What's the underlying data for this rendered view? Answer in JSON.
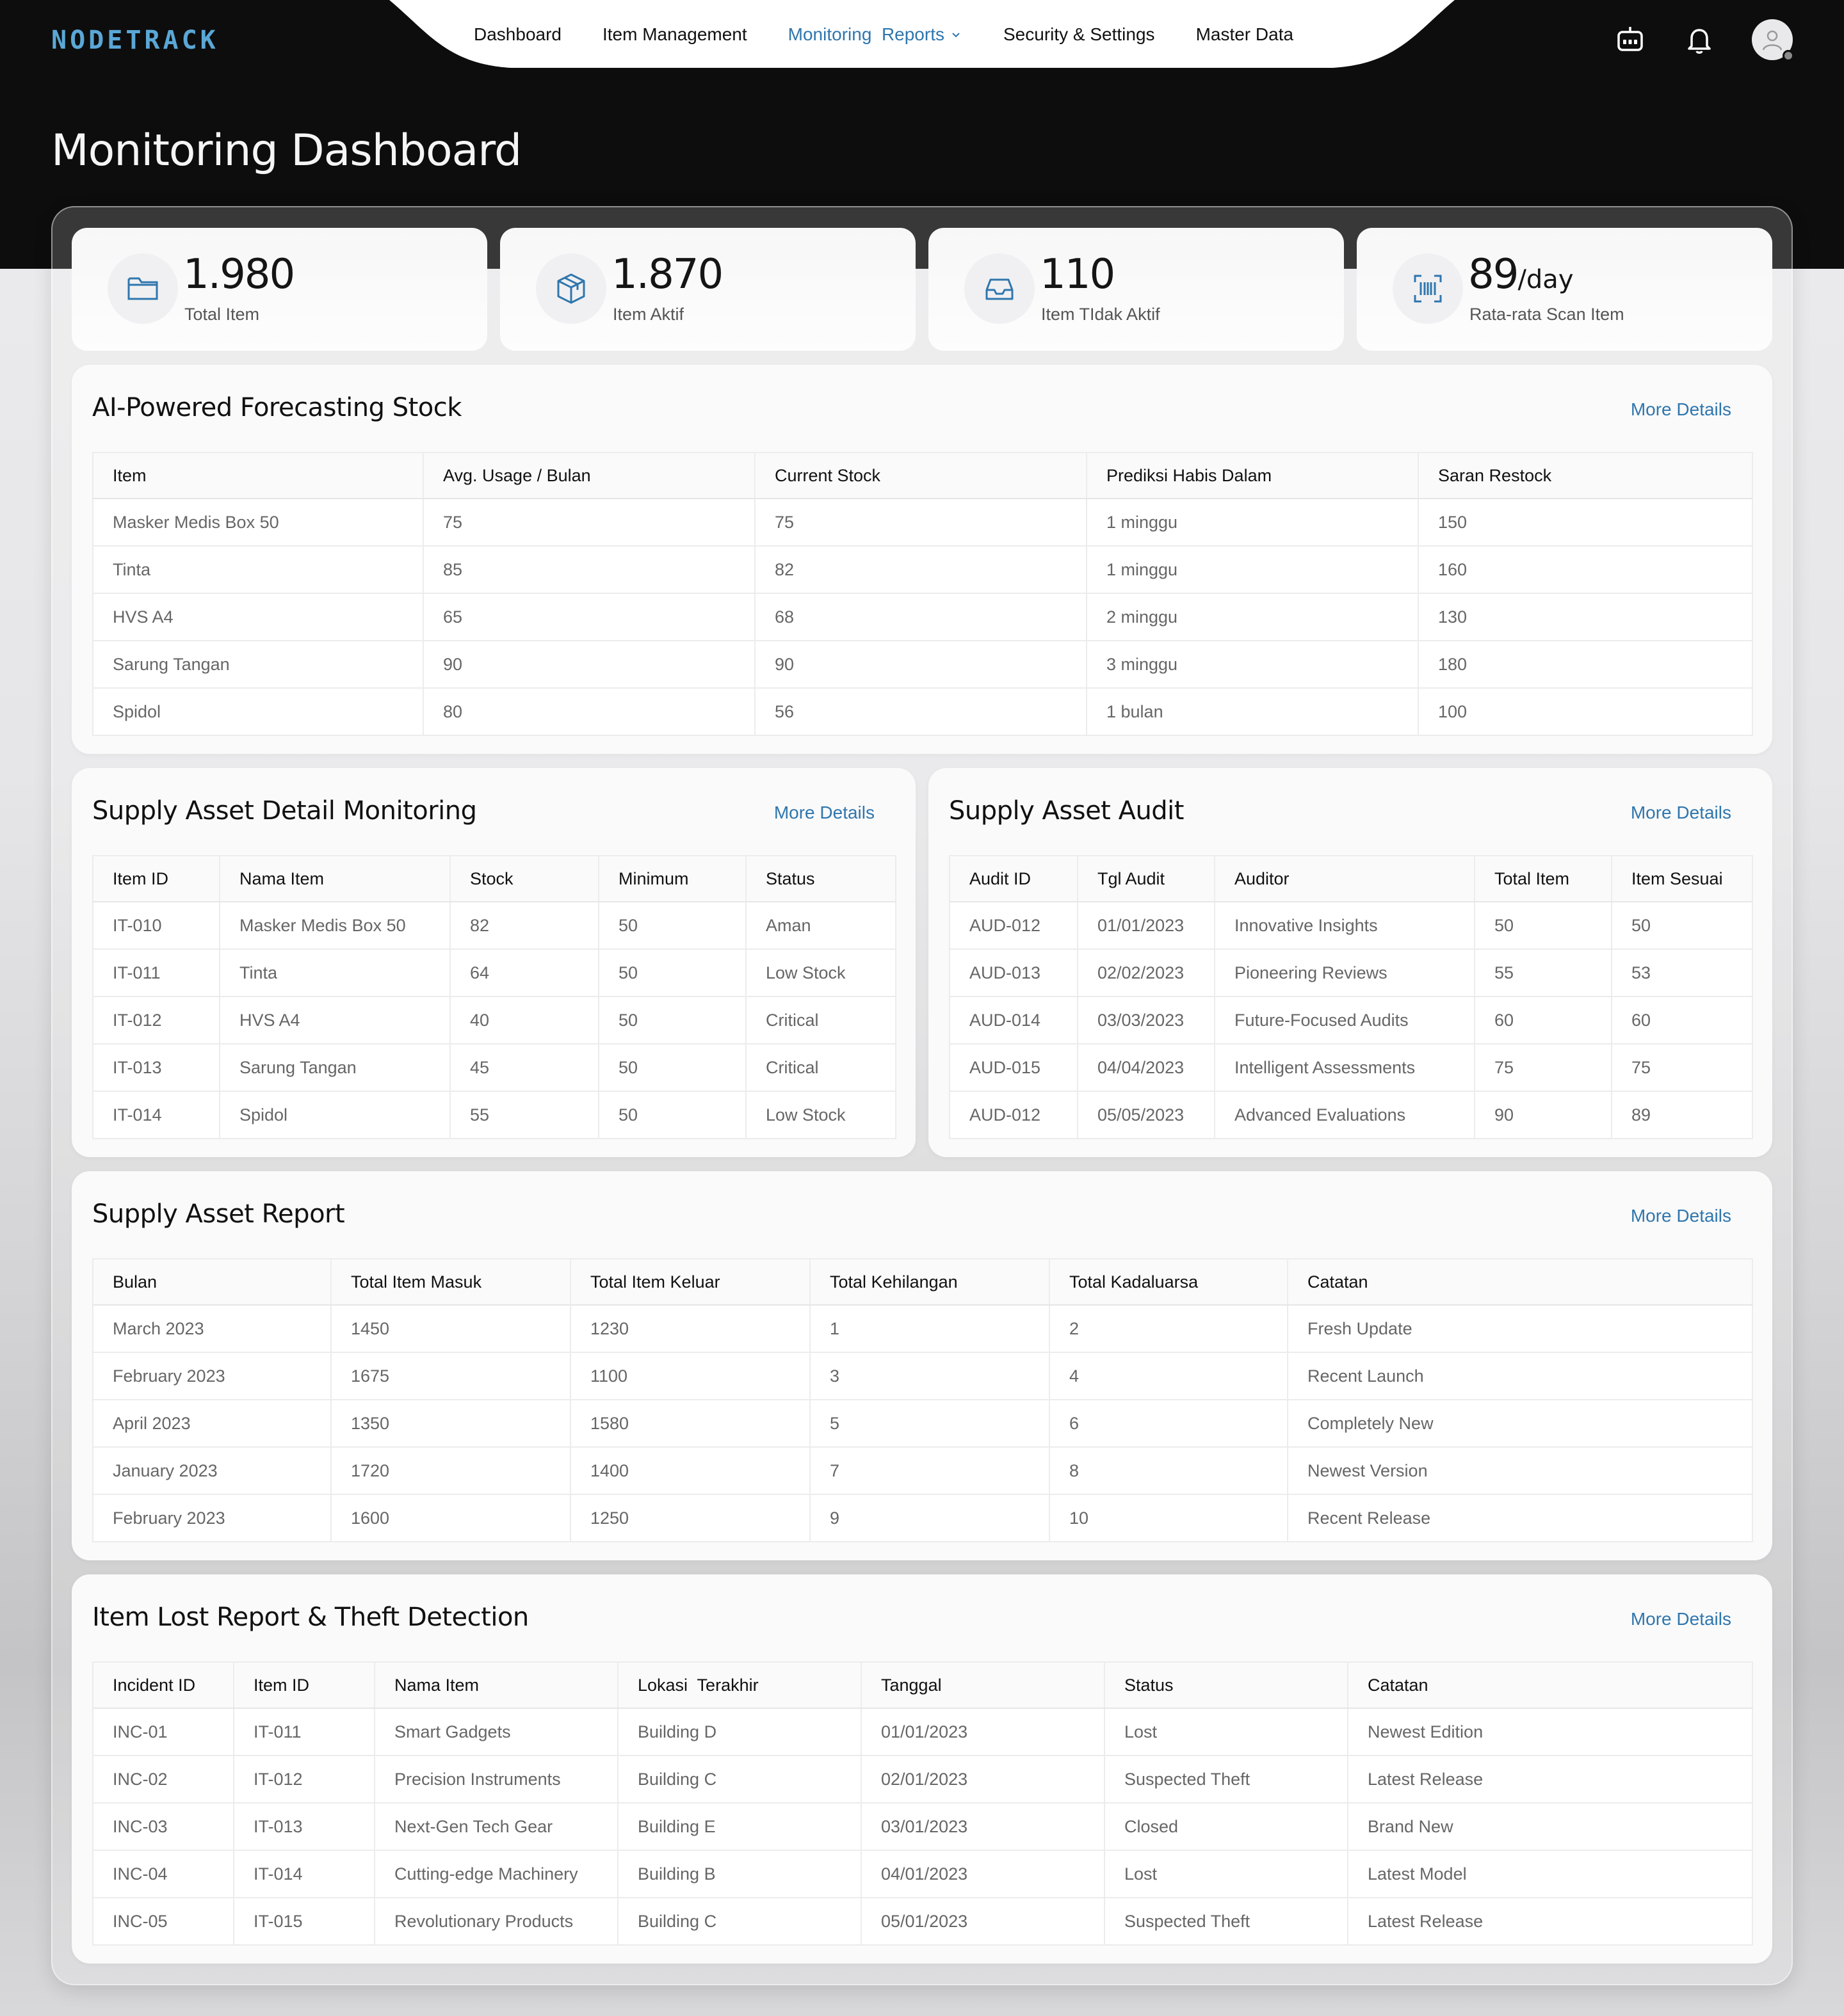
{
  "brand": {
    "logo": "NODETRACK"
  },
  "nav": {
    "items": [
      {
        "label": "Dashboard"
      },
      {
        "label": "Item Management"
      },
      {
        "label": "Monitoring  Reports"
      },
      {
        "label": "Security & Settings"
      },
      {
        "label": "Master Data"
      }
    ],
    "active_index": 2,
    "accent_color": "#2f76ad"
  },
  "header_icons": [
    "bot-icon",
    "bell-icon",
    "avatar-icon"
  ],
  "page_title": "Monitoring Dashboard",
  "stats": [
    {
      "icon": "folder-icon",
      "value": "1.980",
      "unit": "",
      "label": "Total Item"
    },
    {
      "icon": "box-icon",
      "value": "1.870",
      "unit": "",
      "label": "Item Aktif"
    },
    {
      "icon": "inbox-icon",
      "value": "110",
      "unit": "",
      "label": "Item TIdak Aktif"
    },
    {
      "icon": "barcode-scan-icon",
      "value": "89",
      "unit": "/day",
      "label": "Rata-rata Scan Item"
    }
  ],
  "forecast": {
    "title": "AI-Powered Forecasting Stock",
    "more": "More Details",
    "columns": [
      "Item",
      "Avg. Usage / Bulan",
      "Current Stock",
      "Prediksi Habis Dalam",
      "Saran Restock"
    ],
    "rows": [
      [
        "Masker Medis Box 50",
        "75",
        "75",
        "1 minggu",
        "150"
      ],
      [
        "Tinta",
        "85",
        "82",
        "1 minggu",
        "160"
      ],
      [
        "HVS A4",
        "65",
        "68",
        "2 minggu",
        "130"
      ],
      [
        "Sarung Tangan",
        "90",
        "90",
        "3 minggu",
        "180"
      ],
      [
        "Spidol",
        "80",
        "56",
        "1 bulan",
        "100"
      ]
    ]
  },
  "detail_monitoring": {
    "title": "Supply Asset Detail Monitoring",
    "more": "More Details",
    "columns": [
      "Item ID",
      "Nama Item",
      "Stock",
      "Minimum",
      "Status"
    ],
    "rows": [
      [
        "IT-010",
        "Masker Medis Box 50",
        "82",
        "50",
        "Aman"
      ],
      [
        "IT-011",
        "Tinta",
        "64",
        "50",
        "Low Stock"
      ],
      [
        "IT-012",
        "HVS A4",
        "40",
        "50",
        "Critical"
      ],
      [
        "IT-013",
        "Sarung Tangan",
        "45",
        "50",
        "Critical"
      ],
      [
        "IT-014",
        "Spidol",
        "55",
        "50",
        "Low Stock"
      ]
    ]
  },
  "audit": {
    "title": "Supply Asset Audit",
    "more": "More Details",
    "columns": [
      "Audit ID",
      "Tgl Audit",
      "Auditor",
      "Total Item",
      "Item Sesuai"
    ],
    "rows": [
      [
        "AUD-012",
        "01/01/2023",
        "Innovative Insights",
        "50",
        "50"
      ],
      [
        "AUD-013",
        "02/02/2023",
        "Pioneering Reviews",
        "55",
        "53"
      ],
      [
        "AUD-014",
        "03/03/2023",
        "Future-Focused Audits",
        "60",
        "60"
      ],
      [
        "AUD-015",
        "04/04/2023",
        "Intelligent Assessments",
        "75",
        "75"
      ],
      [
        "AUD-012",
        "05/05/2023",
        "Advanced Evaluations",
        "90",
        "89"
      ]
    ]
  },
  "report": {
    "title": "Supply Asset Report",
    "more": "More Details",
    "columns": [
      "Bulan",
      "Total Item Masuk",
      "Total Item Keluar",
      "Total Kehilangan",
      "Total Kadaluarsa",
      "Catatan"
    ],
    "rows": [
      [
        "March 2023",
        "1450",
        "1230",
        "1",
        "2",
        "Fresh Update"
      ],
      [
        "February 2023",
        "1675",
        "1100",
        "3",
        "4",
        "Recent Launch"
      ],
      [
        "April 2023",
        "1350",
        "1580",
        "5",
        "6",
        "Completely New"
      ],
      [
        "January 2023",
        "1720",
        "1400",
        "7",
        "8",
        "Newest Version"
      ],
      [
        "February 2023",
        "1600",
        "1250",
        "9",
        "10",
        "Recent Release"
      ]
    ]
  },
  "lost": {
    "title": "Item Lost Report & Theft Detection",
    "more": "More Details",
    "columns": [
      "Incident ID",
      "Item ID",
      "Nama Item",
      "Lokasi  Terakhir",
      "Tanggal",
      "Status",
      "Catatan"
    ],
    "rows": [
      [
        "INC-01",
        "IT-011",
        "Smart Gadgets",
        "Building D",
        "01/01/2023",
        "Lost",
        "Newest Edition"
      ],
      [
        "INC-02",
        "IT-012",
        "Precision Instruments",
        "Building C",
        "02/01/2023",
        "Suspected Theft",
        "Latest Release"
      ],
      [
        "INC-03",
        "IT-013",
        "Next-Gen Tech Gear",
        "Building E",
        "03/01/2023",
        "Closed",
        "Brand New"
      ],
      [
        "INC-04",
        "IT-014",
        "Cutting-edge Machinery",
        "Building B",
        "04/01/2023",
        "Lost",
        "Latest Model"
      ],
      [
        "INC-05",
        "IT-015",
        "Revolutionary Products",
        "Building C",
        "05/01/2023",
        "Suspected Theft",
        "Latest Release"
      ]
    ]
  }
}
